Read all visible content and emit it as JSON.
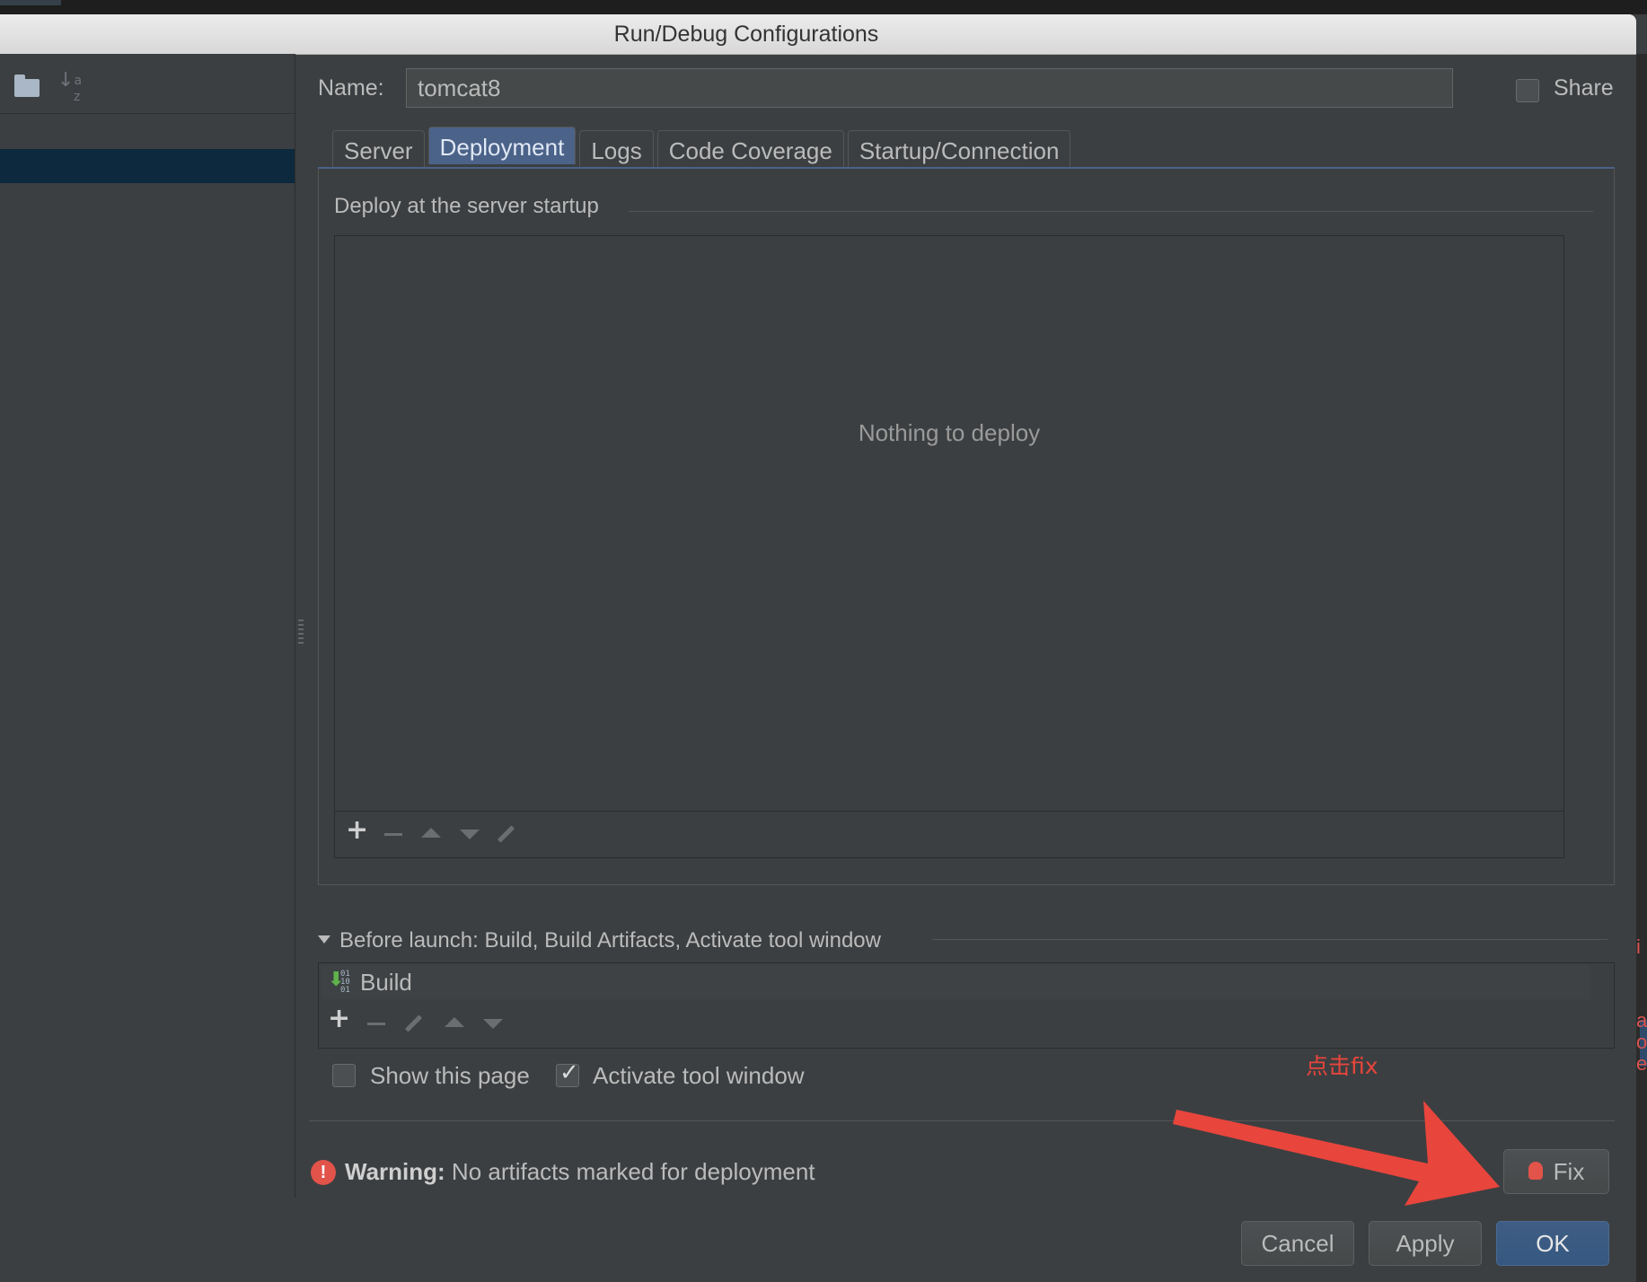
{
  "window": {
    "title": "Run/Debug Configurations"
  },
  "name_row": {
    "label": "Name:",
    "value": "tomcat8",
    "share_label": "Share",
    "share_checked": false
  },
  "tabs": [
    {
      "label": "Server",
      "active": false
    },
    {
      "label": "Deployment",
      "active": true
    },
    {
      "label": "Logs",
      "active": false
    },
    {
      "label": "Code Coverage",
      "active": false
    },
    {
      "label": "Startup/Connection",
      "active": false
    }
  ],
  "deployment": {
    "section_title": "Deploy at the server startup",
    "empty_text": "Nothing to deploy",
    "toolbar": [
      "add-icon",
      "remove-icon",
      "move-up-icon",
      "move-down-icon",
      "edit-icon"
    ]
  },
  "before_launch": {
    "title": "Before launch: Build, Build Artifacts, Activate tool window",
    "items": [
      {
        "label": "Build",
        "icon": "build-icon"
      }
    ],
    "toolbar": [
      "add-icon",
      "remove-icon",
      "edit-icon",
      "move-up-icon",
      "move-down-icon"
    ],
    "show_this_page": {
      "label": "Show this page",
      "checked": false
    },
    "activate_tool_window": {
      "label": "Activate tool window",
      "checked": true
    }
  },
  "annotation": {
    "text": "点击fix",
    "color": "#e8453c"
  },
  "warning": {
    "prefix": "Warning:",
    "message": "No artifacts marked for deployment"
  },
  "buttons": {
    "fix": "Fix",
    "cancel": "Cancel",
    "apply": "Apply",
    "ok": "OK"
  },
  "right_edge_fragments": [
    "i",
    "a",
    "o",
    "e"
  ],
  "colors": {
    "background": "#3c3f41",
    "accent": "#4b6289",
    "ok_button": "#365880",
    "warning": "#e2534a"
  }
}
